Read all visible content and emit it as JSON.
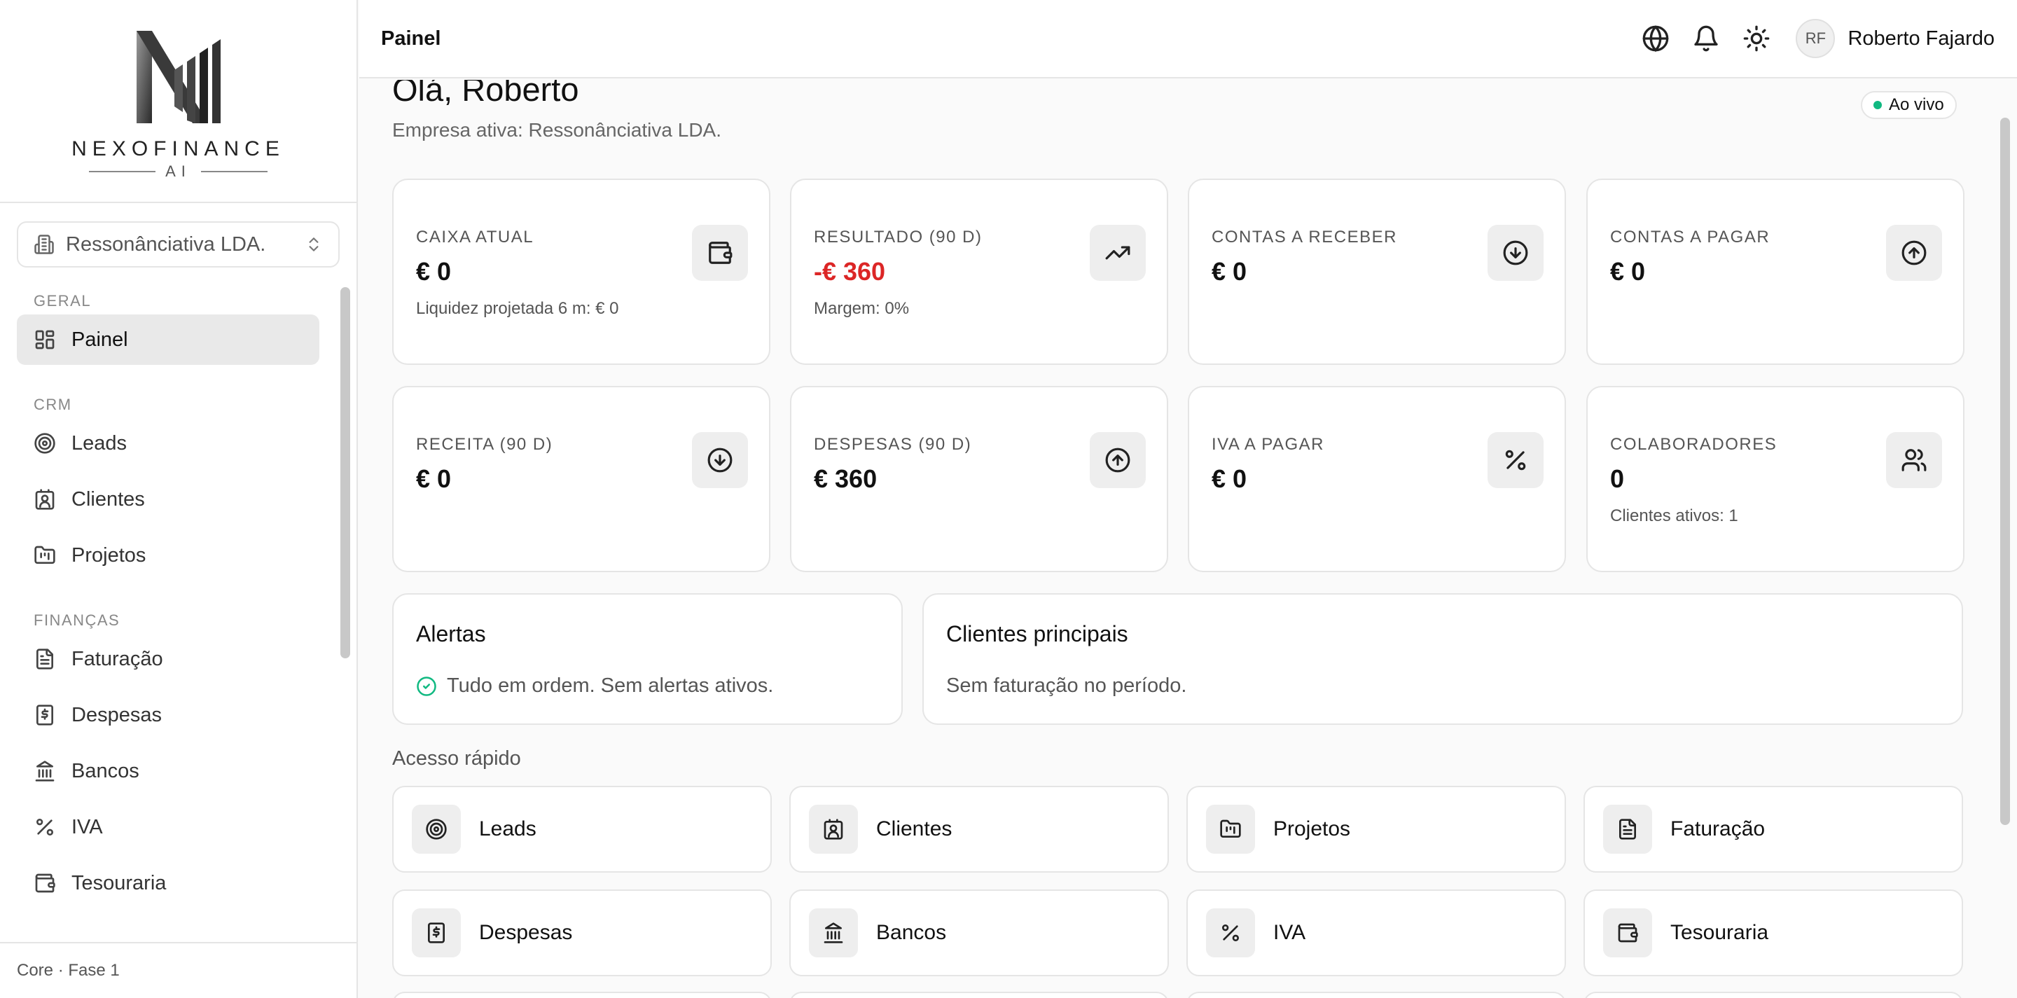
{
  "brand": {
    "name": "NEXOFINANCE",
    "sub": "AI"
  },
  "company_selector": {
    "value": "Ressonânciativa LDA."
  },
  "sidebar": {
    "sections": [
      {
        "label": "GERAL",
        "items": [
          {
            "label": "Painel",
            "icon": "dashboard-icon",
            "active": true
          }
        ]
      },
      {
        "label": "CRM",
        "items": [
          {
            "label": "Leads",
            "icon": "target-icon"
          },
          {
            "label": "Clientes",
            "icon": "contact-icon"
          },
          {
            "label": "Projetos",
            "icon": "folder-icon"
          }
        ]
      },
      {
        "label": "FINANÇAS",
        "items": [
          {
            "label": "Faturação",
            "icon": "file-text-icon"
          },
          {
            "label": "Despesas",
            "icon": "receipt-icon"
          },
          {
            "label": "Bancos",
            "icon": "bank-icon"
          },
          {
            "label": "IVA",
            "icon": "percent-icon"
          },
          {
            "label": "Tesouraria",
            "icon": "wallet-icon"
          }
        ]
      }
    ],
    "footer": "Core · Fase 1"
  },
  "topbar": {
    "title": "Painel",
    "user_initials": "RF",
    "user_name": "Roberto Fajardo"
  },
  "header": {
    "greeting": "Olá, Roberto",
    "subtitle": "Empresa ativa: Ressonânciativa LDA.",
    "live_label": "Ao vivo",
    "live_color": "#10b981"
  },
  "stats": [
    {
      "label": "CAIXA ATUAL",
      "value": "€ 0",
      "sub": "Liquidez projetada 6 m: € 0",
      "icon": "wallet-icon"
    },
    {
      "label": "RESULTADO (90 D)",
      "value": "-€ 360",
      "sub": "Margem: 0%",
      "icon": "trending-up-icon",
      "negative": true
    },
    {
      "label": "CONTAS A RECEBER",
      "value": "€ 0",
      "sub": "",
      "icon": "arrow-down-circle-icon"
    },
    {
      "label": "CONTAS A PAGAR",
      "value": "€ 0",
      "sub": "",
      "icon": "arrow-up-circle-icon"
    },
    {
      "label": "RECEITA (90 D)",
      "value": "€ 0",
      "sub": "",
      "icon": "arrow-down-circle-icon"
    },
    {
      "label": "DESPESAS (90 D)",
      "value": "€ 360",
      "sub": "",
      "icon": "arrow-up-circle-icon"
    },
    {
      "label": "IVA A PAGAR",
      "value": "€ 0",
      "sub": "",
      "icon": "percent-icon"
    },
    {
      "label": "COLABORADORES",
      "value": "0",
      "sub": "Clientes ativos: 1",
      "icon": "users-icon"
    }
  ],
  "negative_color": "#dc2626",
  "alerts": {
    "title": "Alertas",
    "message": "Tudo em ordem. Sem alertas ativos.",
    "ok_color": "#10b981"
  },
  "top_clients": {
    "title": "Clientes principais",
    "message": "Sem faturação no período."
  },
  "quick_access": {
    "title": "Acesso rápido",
    "items": [
      {
        "label": "Leads",
        "icon": "target-icon"
      },
      {
        "label": "Clientes",
        "icon": "contact-icon"
      },
      {
        "label": "Projetos",
        "icon": "folder-icon"
      },
      {
        "label": "Faturação",
        "icon": "file-text-icon"
      },
      {
        "label": "Despesas",
        "icon": "receipt-icon"
      },
      {
        "label": "Bancos",
        "icon": "bank-icon"
      },
      {
        "label": "IVA",
        "icon": "percent-icon"
      },
      {
        "label": "Tesouraria",
        "icon": "wallet-icon"
      }
    ]
  }
}
